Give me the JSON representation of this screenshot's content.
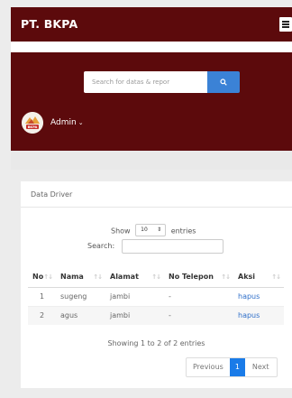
{
  "header": {
    "brand": "PT. BKPA"
  },
  "sidebar": {
    "search_placeholder": "Search for datas & repor",
    "user_name": "Admin",
    "logo_text": "BKPA"
  },
  "card": {
    "title": "Data Driver",
    "show_label": "Show",
    "entries_value": "10",
    "entries_label": "entries",
    "search_label": "Search:",
    "columns": [
      "No",
      "Nama",
      "Alamat",
      "No Telepon",
      "Aksi"
    ],
    "rows": [
      {
        "no": "1",
        "nama": "sugeng",
        "alamat": "jambi",
        "telepon": "-",
        "aksi": "hapus"
      },
      {
        "no": "2",
        "nama": "agus",
        "alamat": "jambi",
        "telepon": "-",
        "aksi": "hapus"
      }
    ],
    "info": "Showing 1 to 2 of 2 entries",
    "pagination": {
      "previous": "Previous",
      "current": "1",
      "next": "Next"
    }
  },
  "colors": {
    "header_bg": "#5c0a0c",
    "accent": "#3b82d6",
    "page_active": "#1a7be8",
    "link": "#2f6fc9"
  }
}
